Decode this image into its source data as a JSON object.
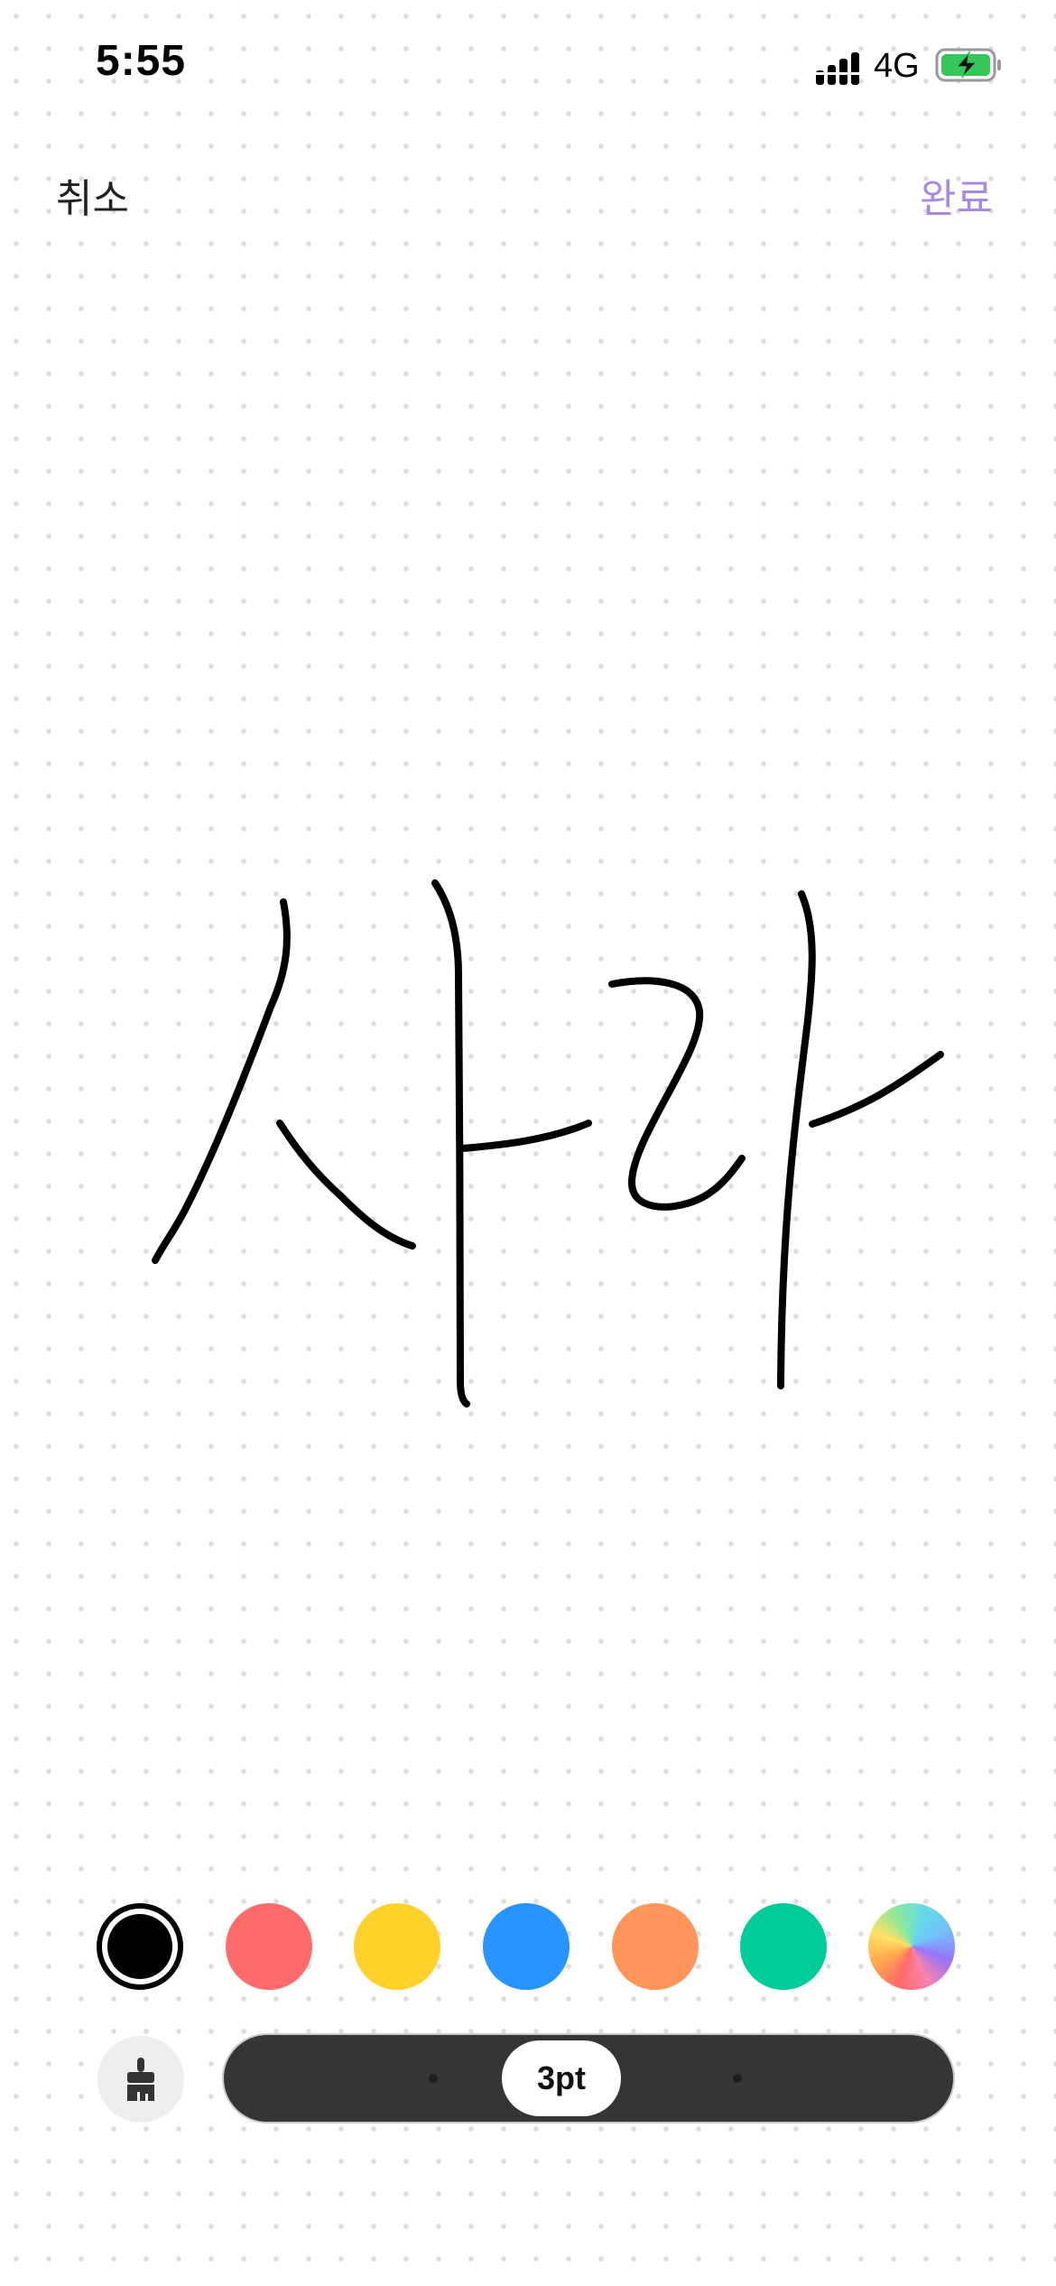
{
  "status_bar": {
    "time": "5:55",
    "network": "4G",
    "signal_icon": "signal-bars-icon",
    "battery_icon": "battery-charging-icon",
    "battery_color": "#34c759"
  },
  "nav": {
    "cancel_label": "취소",
    "done_label": "완료",
    "done_color": "#a889e6"
  },
  "canvas": {
    "stroke_color": "#000000",
    "handwritten_text": "사라"
  },
  "toolbar": {
    "colors": [
      {
        "name": "black",
        "hex": "#000000",
        "selected": true
      },
      {
        "name": "red",
        "hex": "#ff6b6b",
        "selected": false
      },
      {
        "name": "yellow",
        "hex": "#ffd12a",
        "selected": false
      },
      {
        "name": "blue",
        "hex": "#2994ff",
        "selected": false
      },
      {
        "name": "orange",
        "hex": "#ff9559",
        "selected": false
      },
      {
        "name": "green",
        "hex": "#00cc99",
        "selected": false
      },
      {
        "name": "custom",
        "hex": "rainbow",
        "selected": false
      }
    ],
    "brush_icon": "paintbrush-icon",
    "stroke_size_label": "3pt",
    "stroke_size_pt": 3
  }
}
